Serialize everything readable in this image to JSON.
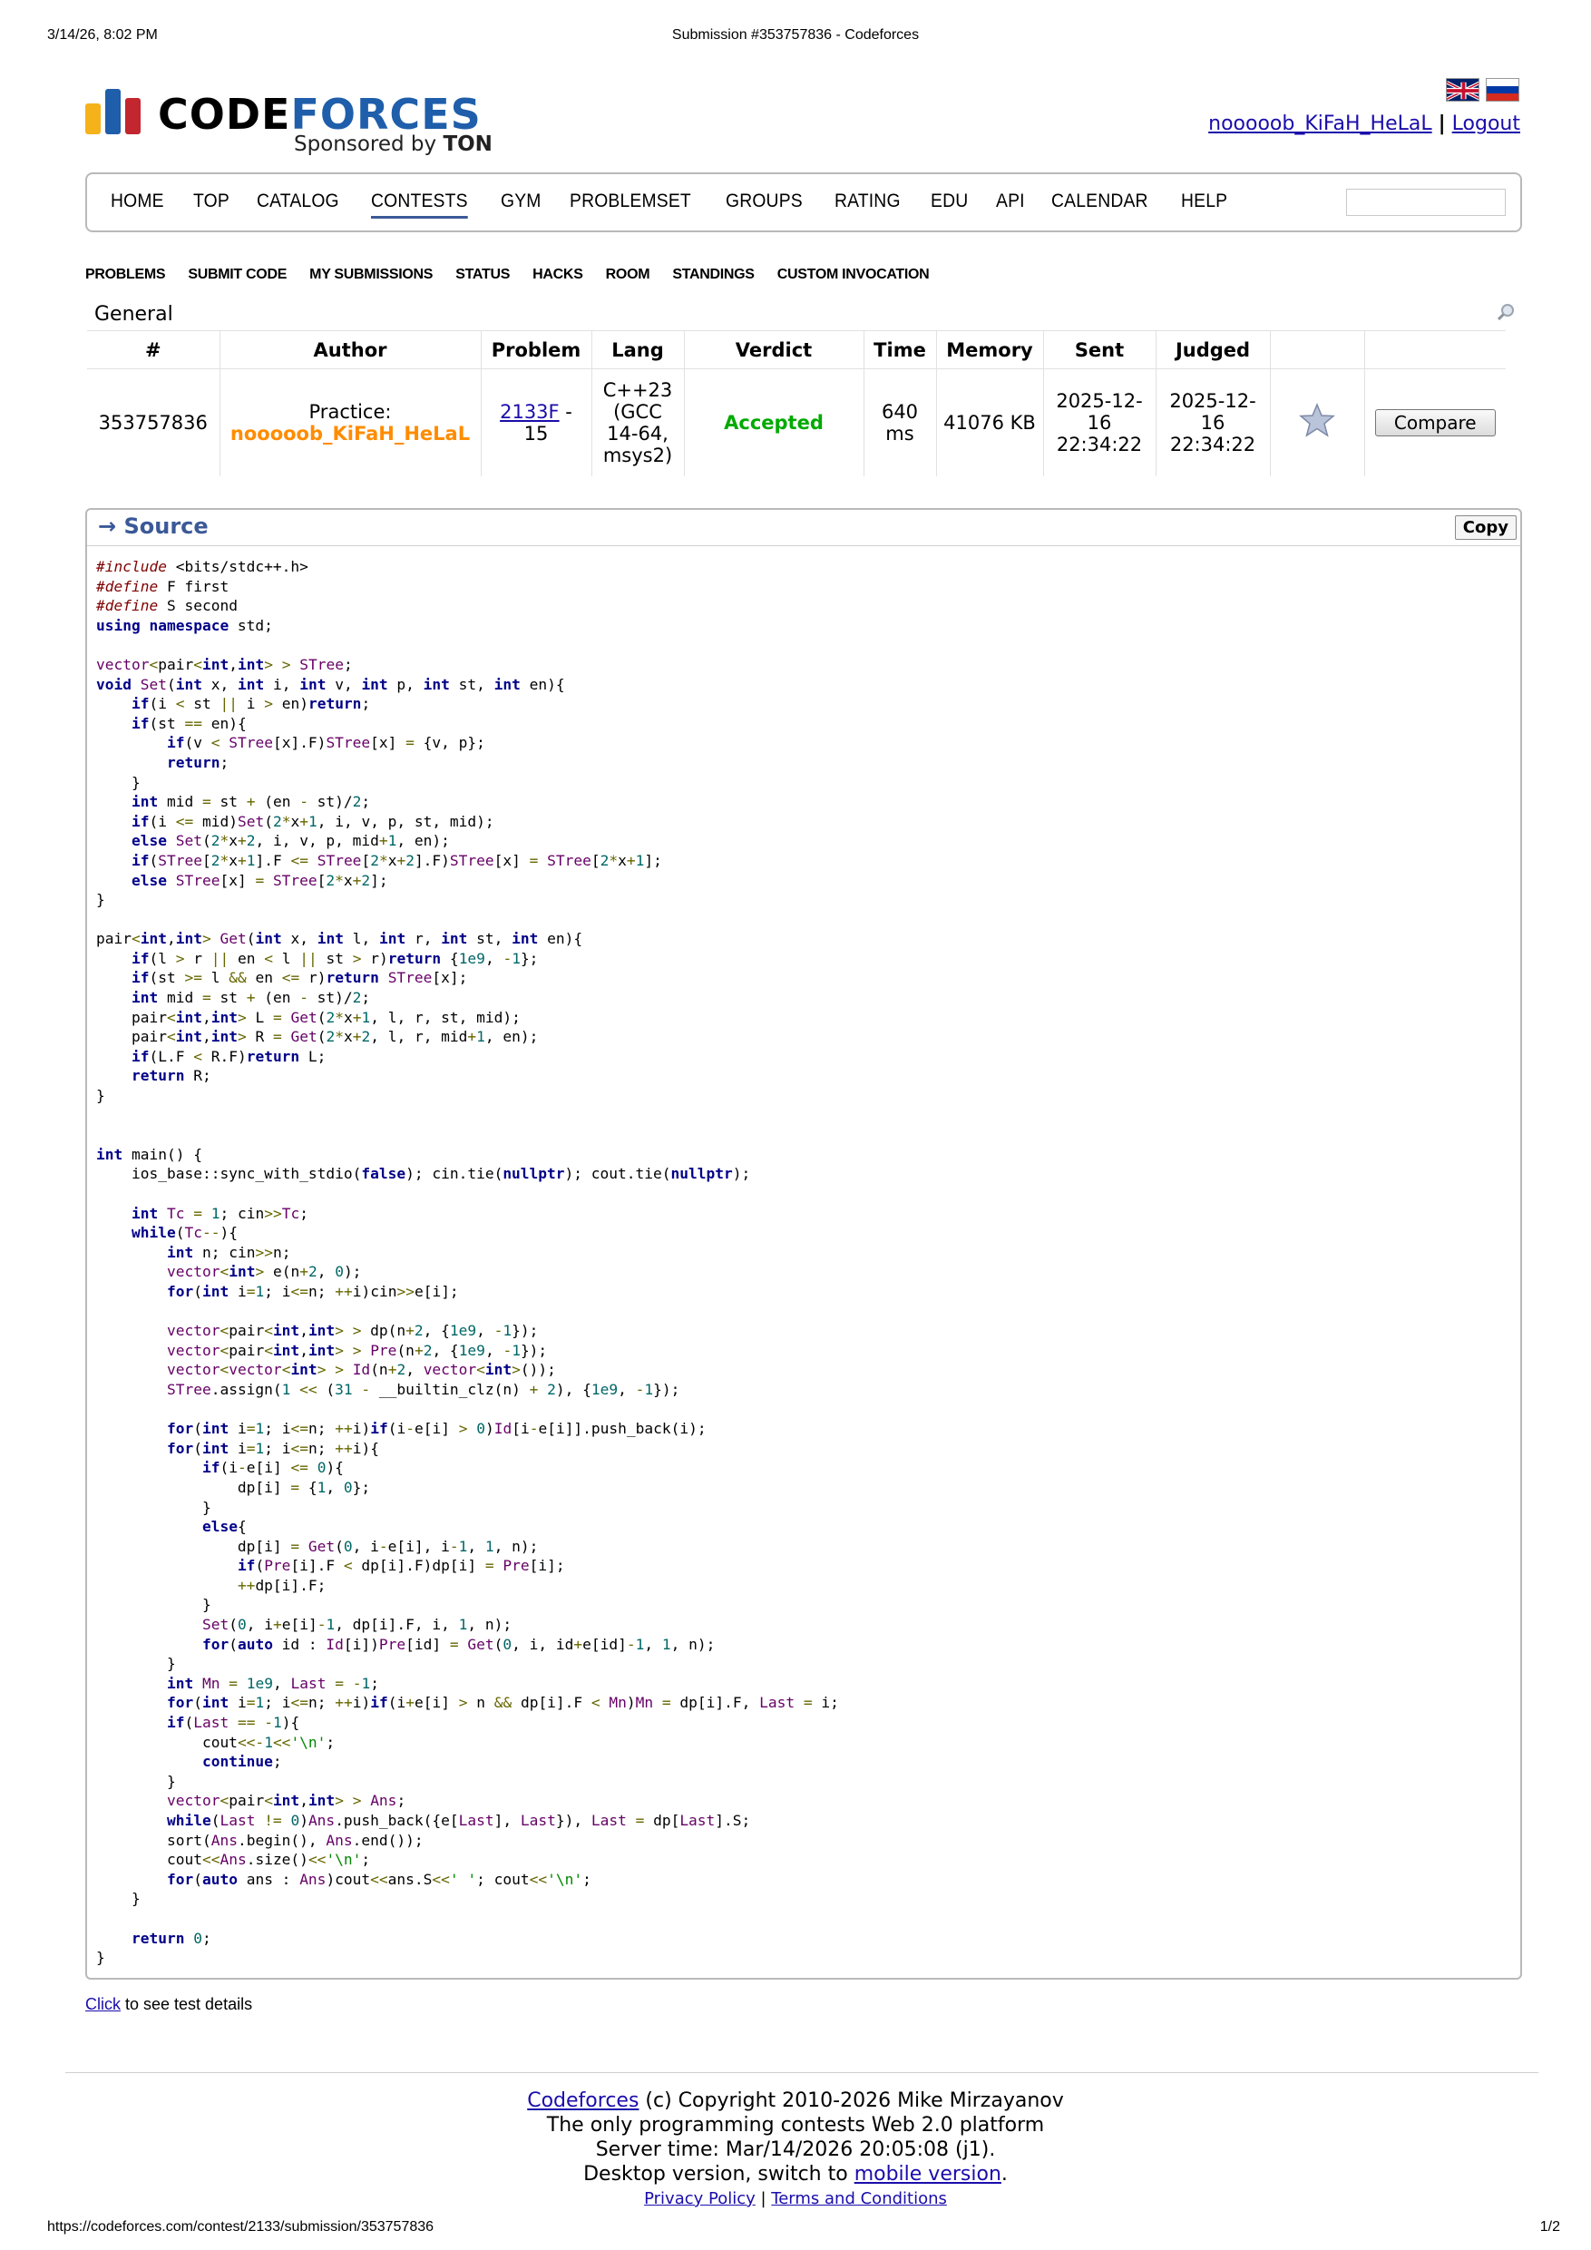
{
  "print_header": {
    "datetime": "3/14/26, 8:02 PM",
    "title": "Submission #353757836 - Codeforces"
  },
  "print_footer": {
    "url": "https://codeforces.com/contest/2133/submission/353757836",
    "page": "1/2"
  },
  "logo": {
    "text_part1": "CODE",
    "text_part2": "FORCES",
    "sponsor_prefix": "Sponsored by ",
    "sponsor_name": "TON",
    "bar_colors": [
      "#f6b21b",
      "#1f5eaa",
      "#c2262e"
    ]
  },
  "user": {
    "handle": "nooooob_KiFaH_HeLaL",
    "separator": "|",
    "logout": "Logout"
  },
  "main_menu": {
    "items": [
      "HOME",
      "TOP",
      "CATALOG",
      "CONTESTS",
      "GYM",
      "PROBLEMSET",
      "GROUPS",
      "RATING",
      "EDU",
      "API",
      "CALENDAR",
      "HELP"
    ],
    "active": "CONTESTS"
  },
  "sub_menu": {
    "items": [
      "PROBLEMS",
      "SUBMIT CODE",
      "MY SUBMISSIONS",
      "STATUS",
      "HACKS",
      "ROOM",
      "STANDINGS",
      "CUSTOM INVOCATION"
    ]
  },
  "general_label": "General",
  "submission_table": {
    "headers": [
      "#",
      "Author",
      "Problem",
      "Lang",
      "Verdict",
      "Time",
      "Memory",
      "Sent",
      "Judged",
      "",
      ""
    ],
    "row": {
      "id": "353757836",
      "author_prefix": "Practice:",
      "author_handle": "nooooob_KiFaH_HeLaL",
      "problem_code": "2133F",
      "problem_suffix": " - 15",
      "lang": "C++23 (GCC 14-64, msys2)",
      "verdict": "Accepted",
      "time": "640 ms",
      "memory": "41076 KB",
      "sent": "2025-12-16 22:34:22",
      "judged": "2025-12-16 22:34:22",
      "compare_label": "Compare"
    }
  },
  "source": {
    "title": "→ Source",
    "copy_label": "Copy"
  },
  "click_line": {
    "link": "Click",
    "text": " to see test details"
  },
  "footer": {
    "brand": "Codeforces",
    "copyright": " (c) Copyright 2010-2026 Mike Mirzayanov",
    "tagline": "The only programming contests Web 2.0 platform",
    "server_time": "Server time: Mar/14/2026 20:05:08 (j1).",
    "desktop_prefix": "Desktop version, switch to ",
    "mobile_link": "mobile version",
    "desktop_suffix": ".",
    "privacy": "Privacy Policy",
    "terms": "Terms and Conditions"
  }
}
